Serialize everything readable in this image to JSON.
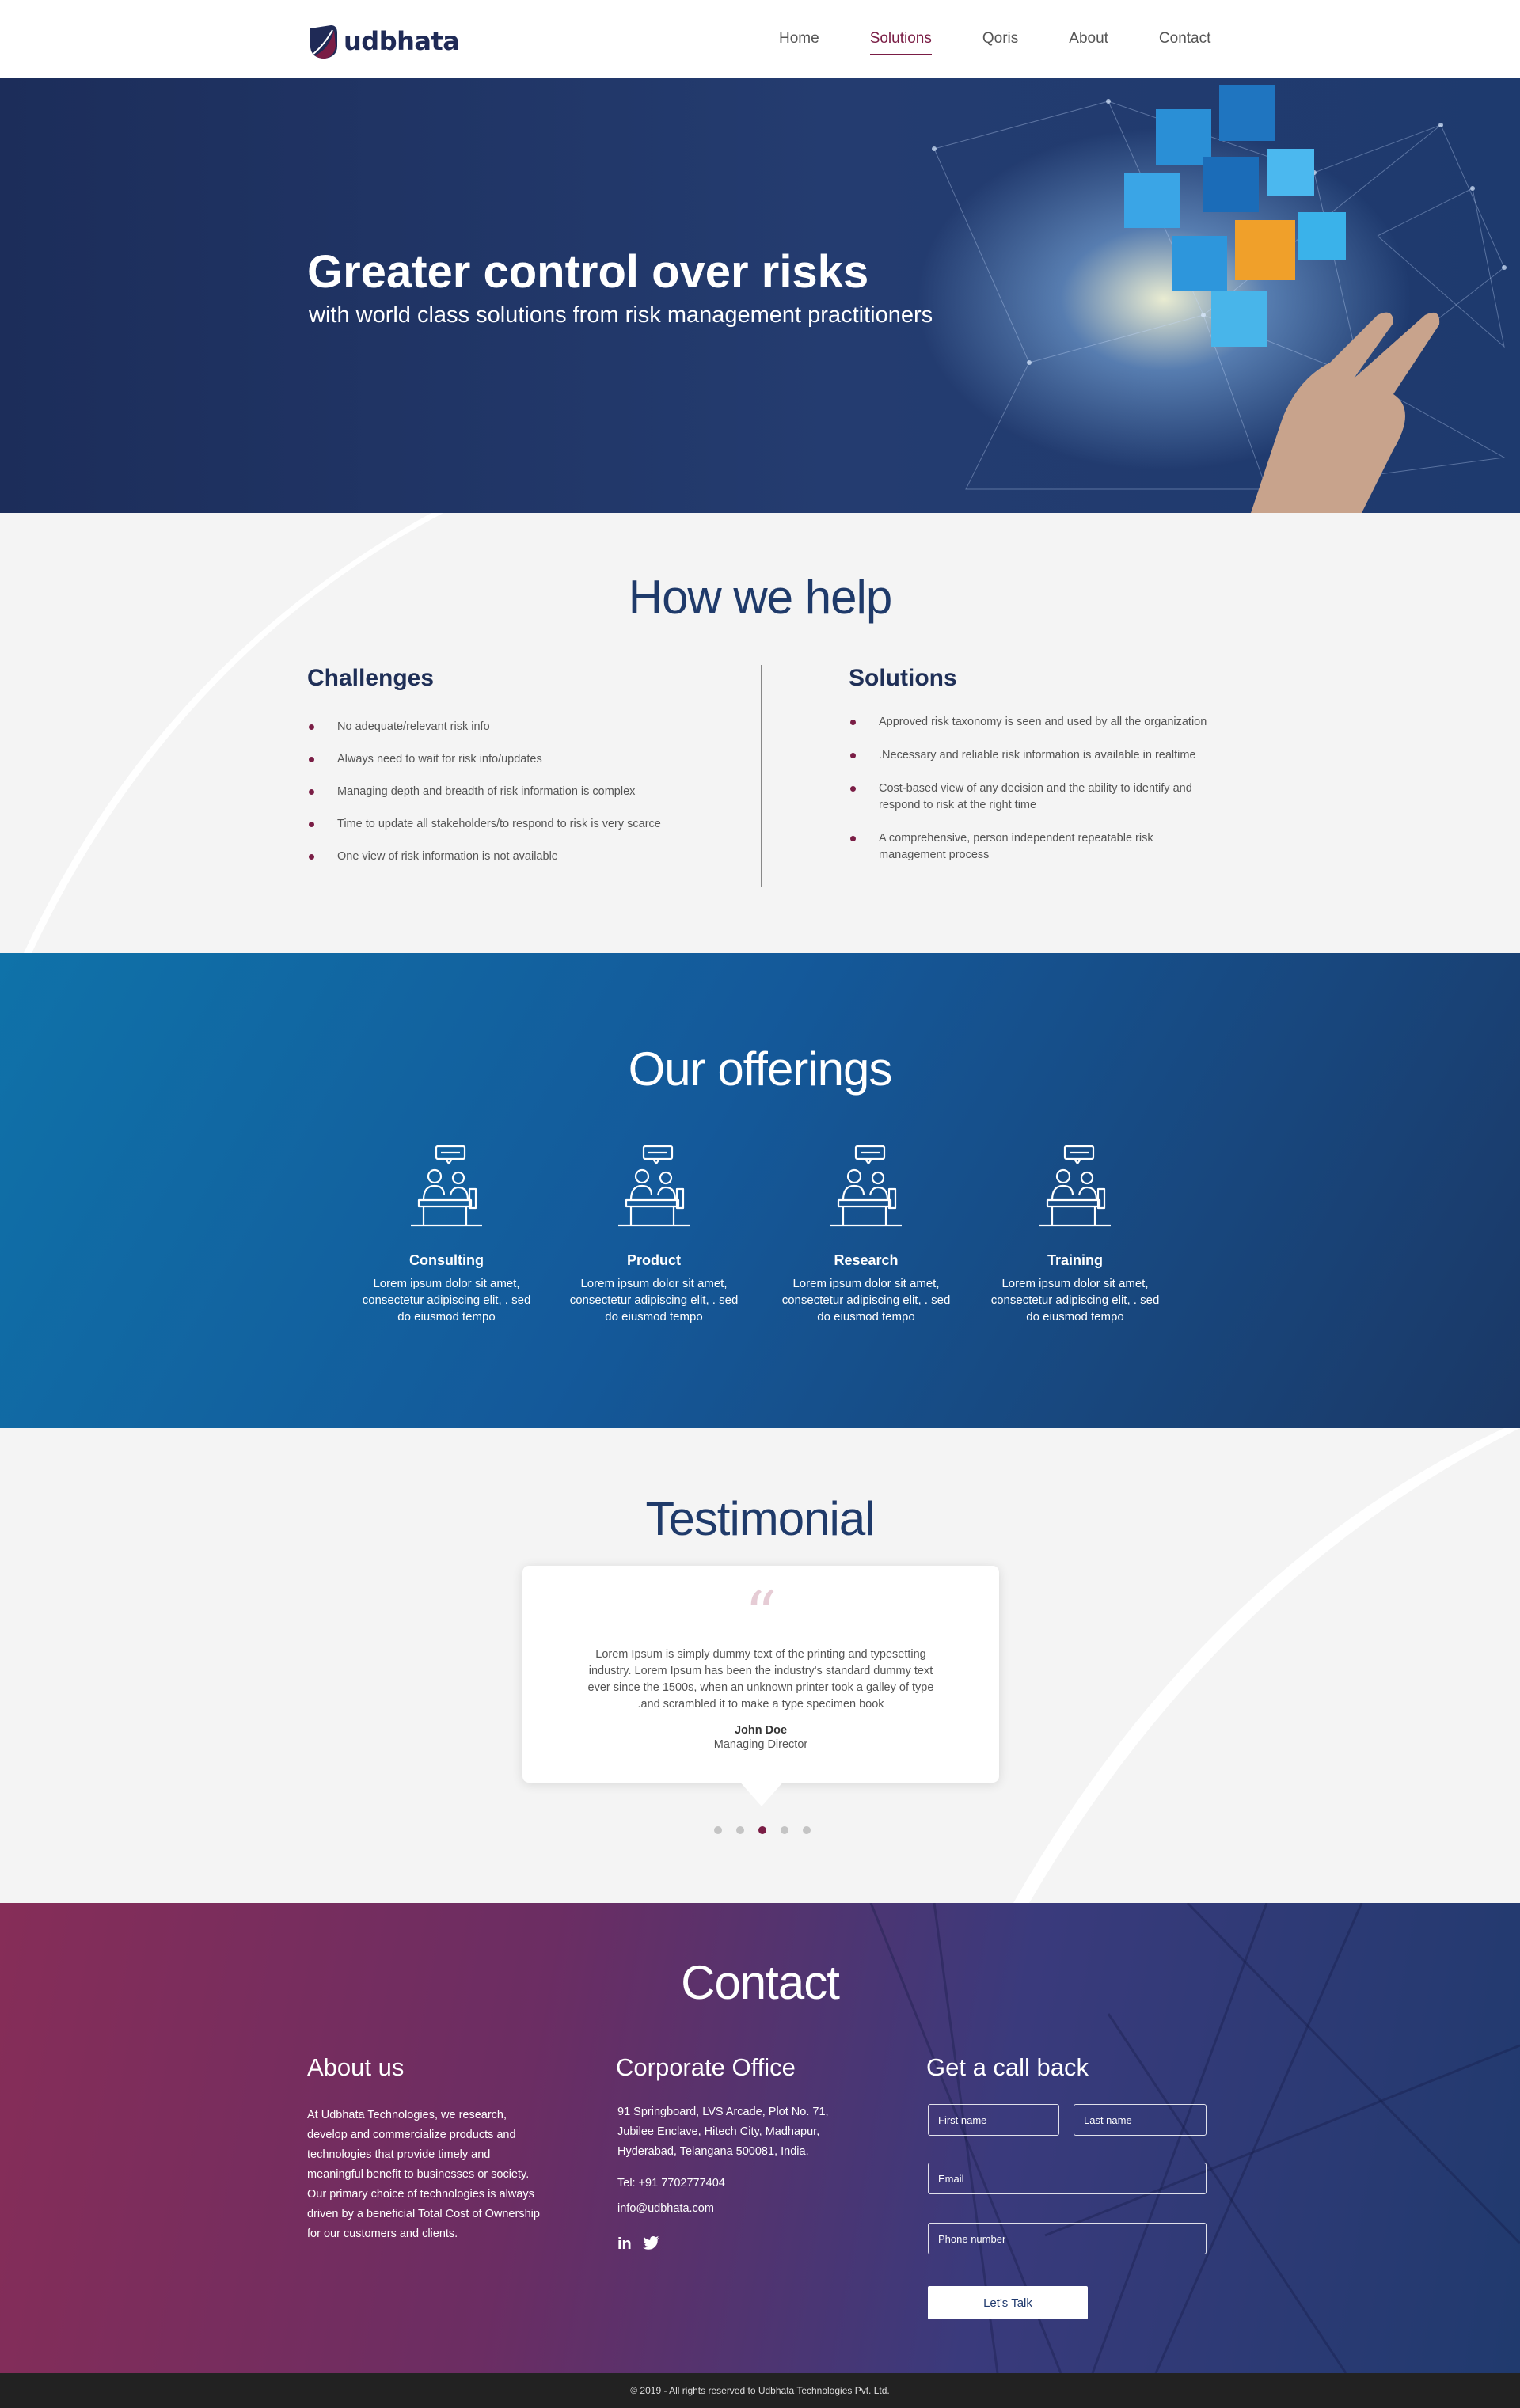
{
  "brand": {
    "name": "udbhata",
    "colors": {
      "primary": "#1f2a56",
      "accent": "#7a1d45"
    }
  },
  "nav": {
    "items": [
      {
        "label": "Home",
        "active": false
      },
      {
        "label": "Solutions",
        "active": true
      },
      {
        "label": "Qoris",
        "active": false
      },
      {
        "label": "About",
        "active": false
      },
      {
        "label": "Contact",
        "active": false
      }
    ]
  },
  "hero": {
    "title": "Greater control over risks",
    "subtitle": "with world class solutions from risk management practitioners"
  },
  "help": {
    "title": "How we help",
    "challenges": {
      "title": "Challenges",
      "items": [
        "No adequate/relevant risk info",
        "Always need to wait for risk info/updates",
        "Managing depth and breadth of risk information is complex",
        "Time to update all stakeholders/to respond to risk is very scarce",
        "One view of risk information is not available"
      ]
    },
    "solutions": {
      "title": "Solutions",
      "items": [
        "Approved risk taxonomy is seen and used by all the organization",
        ".Necessary and reliable risk information is available in realtime",
        "Cost-based view of any decision and the ability to identify and respond to risk at the right time",
        "A comprehensive, person independent repeatable risk management process"
      ]
    }
  },
  "offerings": {
    "title": "Our offerings",
    "items": [
      {
        "name": "Consulting",
        "desc": "Lorem ipsum dolor sit amet, consectetur adipiscing elit, . sed do eiusmod tempo",
        "icon": "presenter-desk-icon"
      },
      {
        "name": "Product",
        "desc": "Lorem ipsum dolor sit amet, consectetur adipiscing elit, . sed do eiusmod tempo",
        "icon": "presenter-desk-icon"
      },
      {
        "name": "Research",
        "desc": "Lorem ipsum dolor sit amet, consectetur adipiscing elit, . sed do eiusmod tempo",
        "icon": "presenter-desk-icon"
      },
      {
        "name": "Training",
        "desc": "Lorem ipsum dolor sit amet, consectetur adipiscing elit, . sed do eiusmod tempo",
        "icon": "presenter-desk-icon"
      }
    ]
  },
  "testimonial": {
    "title": "Testimonial",
    "quote_mark": "“",
    "text": "Lorem Ipsum is simply dummy text of the printing and typesetting industry. Lorem Ipsum has been the industry's standard dummy text ever since the 1500s, when an unknown printer took a galley of type .and scrambled it to make a type specimen book",
    "name": "John Doe",
    "role": "Managing Director",
    "slide_count": 5,
    "active_slide": 3
  },
  "contact": {
    "title": "Contact",
    "about": {
      "title": "About us",
      "text": "At Udbhata Technologies, we research, develop and commercialize products and technologies that provide timely and meaningful benefit to businesses or society. Our primary choice of technologies is always driven by a beneficial Total Cost of Ownership for our customers and clients."
    },
    "office": {
      "title": "Corporate Office",
      "address": "91 Springboard, LVS Arcade, Plot No. 71, Jubilee Enclave, Hitech City, Madhapur, Hyderabad, Telangana 500081, India.",
      "tel": "Tel: +91 7702777404",
      "email": "info@udbhata.com",
      "social": [
        "linkedin-icon",
        "twitter-icon"
      ]
    },
    "callback": {
      "title": "Get a call back",
      "first_name_placeholder": "First name",
      "last_name_placeholder": "Last name",
      "email_placeholder": "Email",
      "phone_placeholder": "Phone number",
      "submit_label": "Let's Talk"
    }
  },
  "footer": {
    "copyright": "© 2019 - All rights reserved to Udbhata Technologies Pvt. Ltd."
  }
}
